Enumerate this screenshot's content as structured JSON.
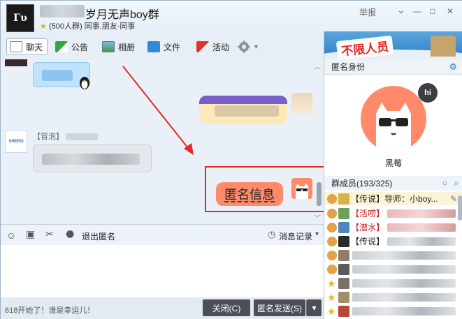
{
  "window": {
    "avatar_text": "Γυ",
    "group_name": "岁月无声boy群",
    "group_sub": "(500人群) 同事.朋友-同事",
    "star": "★",
    "controls": {
      "report": "举报",
      "dropdown": "⌄",
      "minimize": "—",
      "maximize": "□",
      "close": "✕"
    }
  },
  "toolbar": {
    "chat": "聊天",
    "announce": "公告",
    "album": "相册",
    "files": "文件",
    "activity": "活动",
    "settings_caret": "▾"
  },
  "chat": {
    "sender_label": "【冒泡】",
    "shero_logo": "SHERO",
    "anon_message": "匿名信息",
    "scroll_up": "︿",
    "scroll_down": "﹀"
  },
  "input_toolbar": {
    "exit_anon": "退出匿名",
    "message_record": "消息记录",
    "record_caret": "▾"
  },
  "bottom": {
    "status": "618开始了！谁是幸运儿！",
    "close_btn": "关闭(C)",
    "send_btn": "匿名发送(S)",
    "send_caret": "▾"
  },
  "right_panel": {
    "ad_text": "不限人员",
    "anon_identity_title": "匿名身份",
    "hi_text": "hi",
    "anon_name": "黑莓",
    "members_title": "群成员(193/325)",
    "members": [
      {
        "tag": "【传说】",
        "text": "导师：小boy..."
      },
      {
        "tag": "【活唠】",
        "text": ""
      },
      {
        "tag": "【潜水】",
        "text": ""
      },
      {
        "tag": "【传说】",
        "text": ""
      }
    ]
  },
  "colors": {
    "accent_red": "#e02b2b",
    "anon_orange": "#ff8a6a",
    "button_dark": "#4c4f55"
  }
}
